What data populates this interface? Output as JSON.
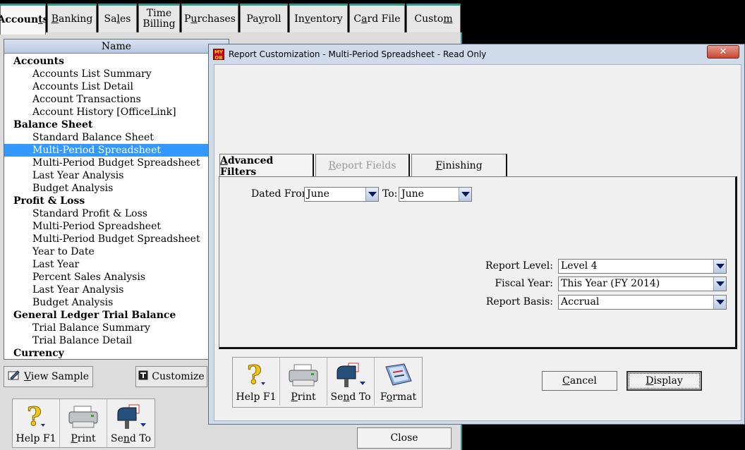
{
  "top_tabs": [
    {
      "pre": "Accoun",
      "u": "t",
      "post": "s",
      "active": true
    },
    {
      "pre": "",
      "u": "B",
      "post": "anking"
    },
    {
      "pre": "Sa",
      "u": "l",
      "post": "es"
    },
    {
      "line1": "Time",
      "line2": "Billing"
    },
    {
      "pre": "P",
      "u": "u",
      "post": "rchases"
    },
    {
      "pre": "Pa",
      "u": "y",
      "post": "roll"
    },
    {
      "pre": "In",
      "u": "v",
      "post": "entory"
    },
    {
      "pre": "C",
      "u": "a",
      "post": "rd File"
    },
    {
      "pre": "Custo",
      "u": "m",
      "post": ""
    }
  ],
  "report_list": {
    "header": "Name",
    "rows": [
      {
        "text": "Accounts",
        "group": true
      },
      {
        "text": "Accounts List Summary"
      },
      {
        "text": "Accounts List Detail"
      },
      {
        "text": "Account Transactions"
      },
      {
        "text": "Account History [OfficeLink]"
      },
      {
        "text": "Balance Sheet",
        "group": true
      },
      {
        "text": "Standard Balance Sheet"
      },
      {
        "text": "Multi-Period Spreadsheet",
        "selected": true
      },
      {
        "text": "Multi-Period Budget Spreadsheet"
      },
      {
        "text": "Last Year Analysis"
      },
      {
        "text": "Budget Analysis"
      },
      {
        "text": "Profit & Loss",
        "group": true
      },
      {
        "text": "Standard Profit & Loss"
      },
      {
        "text": "Multi-Period Spreadsheet"
      },
      {
        "text": "Multi-Period Budget Spreadsheet"
      },
      {
        "text": "Year to Date"
      },
      {
        "text": "Last Year"
      },
      {
        "text": "Percent Sales Analysis"
      },
      {
        "text": "Last Year Analysis"
      },
      {
        "text": "Budget Analysis"
      },
      {
        "text": "General Ledger Trial Balance",
        "group": true
      },
      {
        "text": "Trial Balance Summary"
      },
      {
        "text": "Trial Balance Detail"
      },
      {
        "text": "Currency",
        "group": true
      }
    ]
  },
  "back_buttons": {
    "view_sample_pre": "",
    "view_sample_u": "V",
    "view_sample_post": "iew Sample",
    "customize": "Customize"
  },
  "back_toolbar": [
    {
      "label": "Help F1",
      "icon": "help-icon"
    },
    {
      "pre": "",
      "u": "P",
      "post": "rint",
      "icon": "printer-icon"
    },
    {
      "pre": "Se",
      "u": "n",
      "post": "d To",
      "icon": "mailbox-icon"
    }
  ],
  "close_label": "Close",
  "dialog": {
    "app_icon_text": "MY OB",
    "title": "Report Customization - Multi-Period Spreadsheet - Read Only",
    "close_glyph": "✕",
    "tabs": [
      {
        "pre": "",
        "u": "A",
        "post": "dvanced Filters",
        "state": "active"
      },
      {
        "pre": "",
        "u": "R",
        "post": "eport Fields",
        "state": "disabled"
      },
      {
        "pre": "",
        "u": "F",
        "post": "inishing",
        "state": "normal"
      }
    ],
    "filters": {
      "dated_from_label": "Dated From:",
      "dated_from_value": "June",
      "to_label": "To:",
      "to_value": "June",
      "report_level_label": "Report Level:",
      "report_level_value": "Level 4",
      "fiscal_year_label": "Fiscal Year:",
      "fiscal_year_value": "This Year (FY 2014)",
      "report_basis_label": "Report Basis:",
      "report_basis_value": "Accrual"
    },
    "toolbar": [
      {
        "label": "Help F1",
        "icon": "help-icon"
      },
      {
        "pre": "",
        "u": "P",
        "post": "rint",
        "icon": "printer-icon"
      },
      {
        "pre": "Se",
        "u": "n",
        "post": "d To",
        "icon": "mailbox-icon"
      },
      {
        "pre": "F",
        "u": "o",
        "post": "rmat",
        "icon": "format-icon"
      }
    ],
    "cancel_pre": "",
    "cancel_u": "C",
    "cancel_post": "ancel",
    "display_pre": "",
    "display_u": "D",
    "display_post": "isplay"
  }
}
